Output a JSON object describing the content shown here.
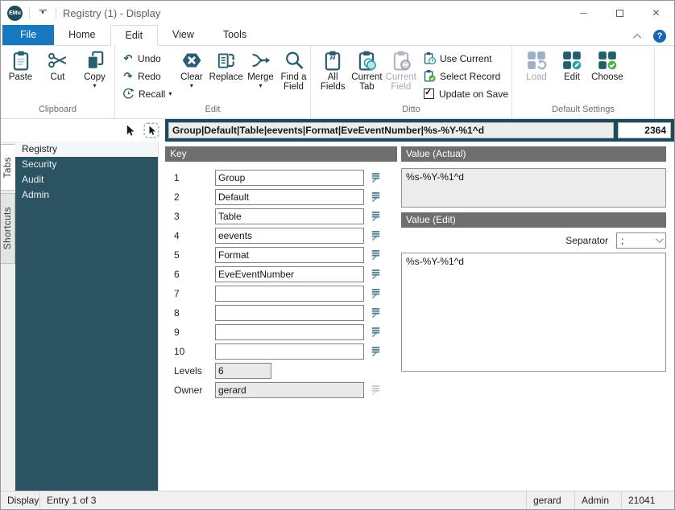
{
  "colors": {
    "accent_teal": "#285E6F",
    "path_bar_teal": "#1C4B5D",
    "sidebar_teal": "#2B5362",
    "header_grey": "#6E6E6E",
    "file_tab_blue": "#1679C0",
    "help_blue": "#1566B5",
    "badge_teal": "#2AA3AC",
    "check_green": "#4CB043",
    "disabled_grey": "#9FAFC4"
  },
  "glyphs": {
    "dropdown": "▾",
    "undo": "↶",
    "redo": "↷",
    "minimize": "─",
    "close": "✕",
    "help": "?"
  },
  "titlebar": {
    "logo": "EMu",
    "title": "Registry (1) - Display"
  },
  "ribbon": {
    "tabs": [
      "File",
      "Home",
      "Edit",
      "View",
      "Tools"
    ],
    "active_tab": "Edit",
    "clipboard": {
      "label": "Clipboard",
      "paste": "Paste",
      "cut": "Cut",
      "copy": "Copy"
    },
    "edit": {
      "label": "Edit",
      "undo": "Undo",
      "redo": "Redo",
      "recall": "Recall",
      "clear": "Clear",
      "replace": "Replace",
      "merge": "Merge",
      "find_a_field": "Find a Field"
    },
    "ditto": {
      "label": "Ditto",
      "all_fields": "All Fields",
      "current_tab": "Current Tab",
      "current_field": "Current Field",
      "use_current": "Use Current",
      "select_record": "Select Record",
      "update_on_save": "Update on Save",
      "update_on_save_checked": true
    },
    "default_settings": {
      "label": "Default Settings",
      "load": "Load",
      "edit": "Edit",
      "choose": "Choose"
    }
  },
  "toolbar": {
    "key_path": "Group|Default|Table|eevents|Format|EveEventNumber|%s-%Y-%1^d",
    "record_count": "2364"
  },
  "sidebar": {
    "tabs": [
      "Tabs",
      "Shortcuts"
    ],
    "active_tab": "Tabs",
    "items": [
      {
        "label": "Registry",
        "selected": true
      },
      {
        "label": "Security",
        "selected": false
      },
      {
        "label": "Audit",
        "selected": false
      },
      {
        "label": "Admin",
        "selected": false
      }
    ]
  },
  "key_panel": {
    "header": "Key",
    "rows": [
      {
        "n": "1",
        "v": "Group"
      },
      {
        "n": "2",
        "v": "Default"
      },
      {
        "n": "3",
        "v": "Table"
      },
      {
        "n": "4",
        "v": "eevents"
      },
      {
        "n": "5",
        "v": "Format"
      },
      {
        "n": "6",
        "v": "EveEventNumber"
      },
      {
        "n": "7",
        "v": ""
      },
      {
        "n": "8",
        "v": ""
      },
      {
        "n": "9",
        "v": ""
      },
      {
        "n": "10",
        "v": ""
      }
    ],
    "levels_label": "Levels",
    "levels_value": "6",
    "owner_label": "Owner",
    "owner_value": "gerard"
  },
  "value_panel": {
    "actual_header": "Value (Actual)",
    "actual_value": "%s-%Y-%1^d",
    "edit_header": "Value (Edit)",
    "separator_label": "Separator",
    "separator_value": ";",
    "edit_value": "%s-%Y-%1^d"
  },
  "statusbar": {
    "mode": "Display",
    "entry": "Entry 1 of 3",
    "user": "gerard",
    "group": "Admin",
    "number": "21041"
  }
}
